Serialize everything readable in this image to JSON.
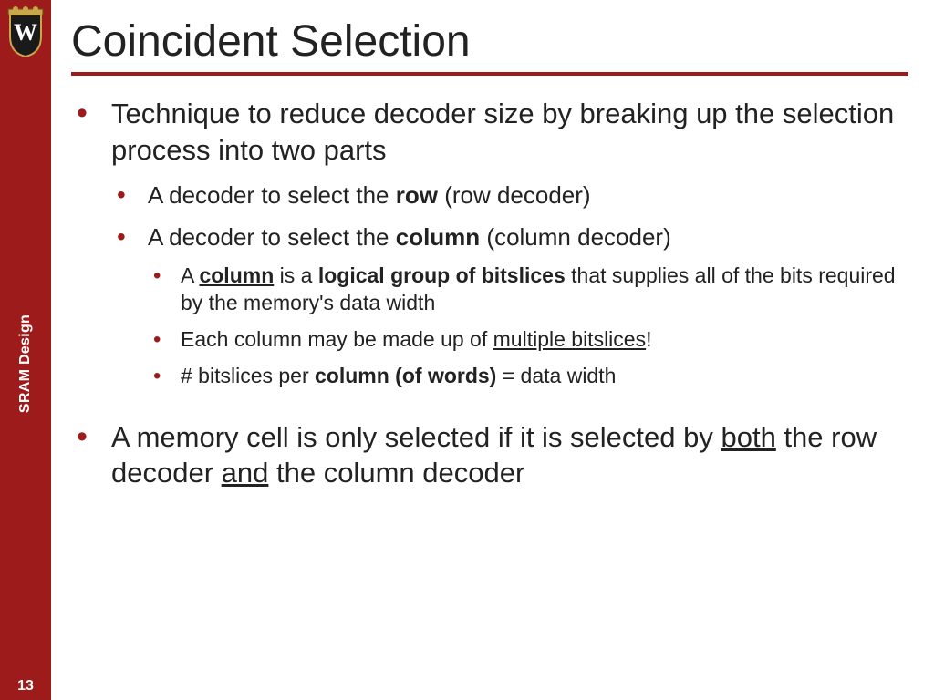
{
  "sidebar": {
    "label": "SRAM Design",
    "page_number": "13",
    "accent_color": "#9e1b1b"
  },
  "title": "Coincident Selection",
  "bullets": {
    "l1_0": "Technique to reduce decoder size by breaking up the selection process into two parts",
    "l2_0a": "A decoder to select the ",
    "l2_0b": "row",
    "l2_0c": " (row decoder)",
    "l2_1a": "A decoder to select the ",
    "l2_1b": "column",
    "l2_1c": " (column decoder)",
    "l3_0a": "A ",
    "l3_0b": "column",
    "l3_0c": " is a ",
    "l3_0d": "logical group of bitslices",
    "l3_0e": " that supplies all of the bits required by the memory's data width",
    "l3_1a": "Each column may be made up of ",
    "l3_1b": "multiple bitslices",
    "l3_1c": "!",
    "l3_2a": "# bitslices per ",
    "l3_2b": "column (of words)",
    "l3_2c": " = data width",
    "l1_1a": "A memory cell is only selected if it is selected by ",
    "l1_1b": "both",
    "l1_1c": " the row decoder ",
    "l1_1d": "and",
    "l1_1e": " the column decoder"
  }
}
